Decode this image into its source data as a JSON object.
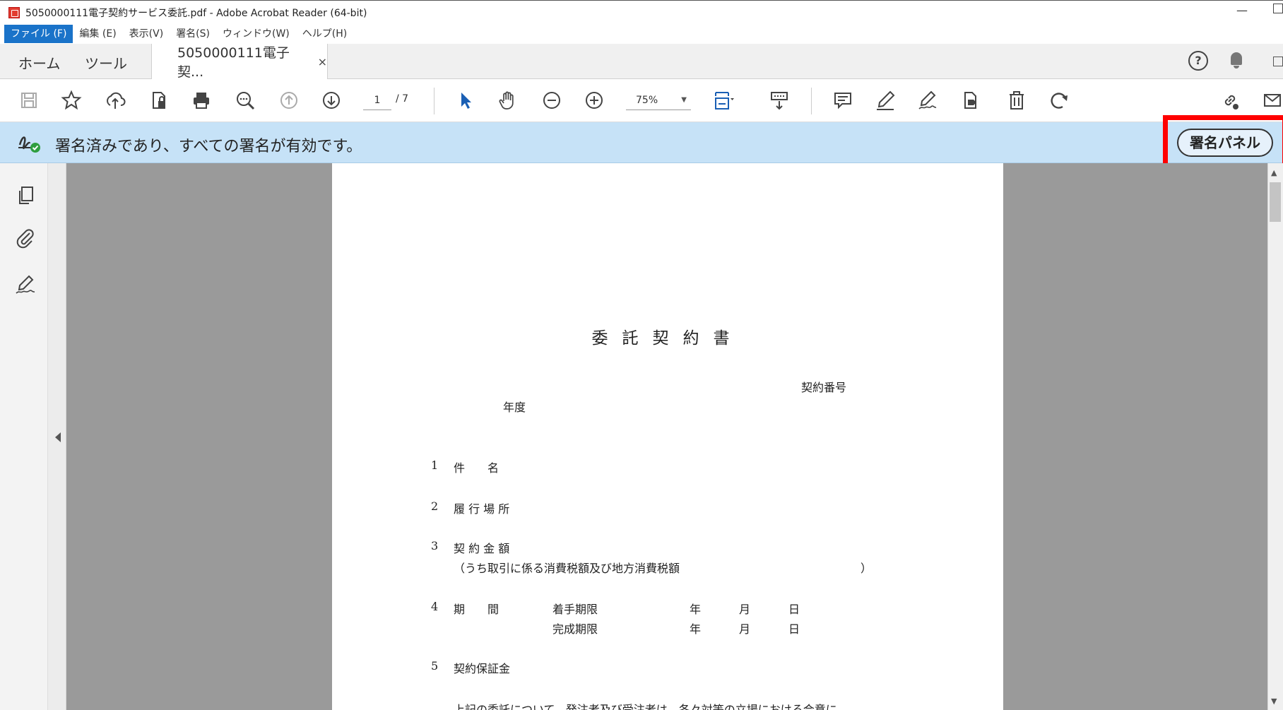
{
  "window": {
    "title": "5050000111電子契約サービス委託.pdf - Adobe Acrobat Reader (64-bit)",
    "minimize_glyph": "—"
  },
  "menu": {
    "items": [
      "ファイル (F)",
      "編集 (E)",
      "表示(V)",
      "署名(S)",
      "ウィンドウ(W)",
      "ヘルプ(H)"
    ]
  },
  "tabs": {
    "home": "ホーム",
    "tools": "ツール",
    "document": "5050000111電子契...",
    "close": "×",
    "help": "?"
  },
  "toolbar": {
    "page_current": "1",
    "page_total": "/ 7",
    "zoom": "75%",
    "zoom_arrow": "▼",
    "icons": [
      "save-icon",
      "bookmark-star-icon",
      "upload-cloud-icon",
      "protect-file-icon",
      "print-icon",
      "search-zoom-icon",
      "previous-page-icon",
      "next-page-icon",
      "select-arrow-icon",
      "hand-icon",
      "zoom-out-icon",
      "zoom-in-icon",
      "fit-page-icon",
      "scroll-mode-icon",
      "comment-icon",
      "highlight-pen-icon",
      "sign-icon",
      "fill-sign-icon",
      "delete-icon",
      "rotate-icon",
      "share-link-icon",
      "mail-icon"
    ]
  },
  "signature_bar": {
    "message": "署名済みであり、すべての署名が有効です。",
    "panel_button": "署名パネル"
  },
  "document": {
    "title": "委託契約書",
    "contract_number_label": "契約番号",
    "fiscal_year_label": "年度",
    "items": [
      {
        "num": "1",
        "label": "件　　名"
      },
      {
        "num": "2",
        "label": "履 行 場 所"
      },
      {
        "num": "3",
        "label": "契 約 金 額"
      },
      {
        "num": "4",
        "label": "期　　間"
      },
      {
        "num": "5",
        "label": "契約保証金"
      }
    ],
    "tax_note": "（うち取引に係る消費税額及び地方消費税額",
    "tax_note_close": "）",
    "start_deadline": "着手期限",
    "completion_deadline": "完成期限",
    "year": "年",
    "month": "月",
    "day": "日",
    "footer_text": "上記の委託について、発注者及び受注者は、各々対等の立場における合意に"
  },
  "scrollbar": {
    "up": "▲",
    "down": "▼"
  }
}
